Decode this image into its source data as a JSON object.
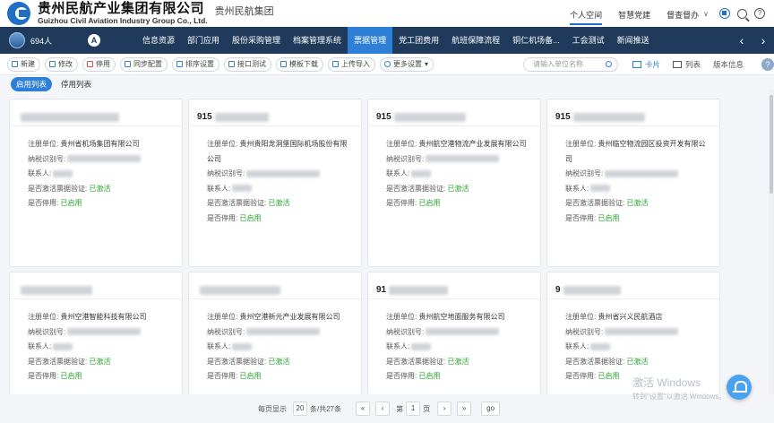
{
  "header": {
    "logo_cn": "贵州民航产业集团有限公司",
    "logo_en": "Guizhou Civil Aviation Industry Group Co., Ltd.",
    "sub": "贵州民航集团",
    "links": [
      "个人空间",
      "智慧党建",
      "督查督办"
    ]
  },
  "nav": {
    "user_count": "694人",
    "a_label": "A",
    "items": [
      "信息资源",
      "部门应用",
      "股份采购管理",
      "档案管理系统",
      "票据管理",
      "党工团费用",
      "航班保障流程",
      "铜仁机场备...",
      "工会测试",
      "新闻推送"
    ],
    "left_arrow": "‹",
    "right_arrow": "›"
  },
  "toolbar": {
    "buttons": [
      "新建",
      "修改",
      "停用",
      "同步配置",
      "排序设置",
      "接口测试",
      "模板下载",
      "上传导入",
      "更多设置"
    ],
    "search_placeholder": "请输入单位名称",
    "view_card": "卡片",
    "view_list": "列表",
    "version": "版本信息",
    "help": "?"
  },
  "subtabs": [
    "启用列表",
    "停用列表"
  ],
  "labels": {
    "unit": "注册单位:",
    "tax": "纳税识别号:",
    "contact": "联系人:",
    "activate": "是否激活票据验证:",
    "disabled": "是否停用:"
  },
  "cards": [
    {
      "code_prefix": "",
      "unit": "贵州省机场集团有限公司",
      "activate": "已激活",
      "disabled": "已启用"
    },
    {
      "code_prefix": "915",
      "unit": "贵州贵阳龙洞堡国际机场股份有限公司",
      "activate": "已激活",
      "disabled": "已启用"
    },
    {
      "code_prefix": "915",
      "unit": "贵州航空港物流产业发展有限公司",
      "activate": "已激活",
      "disabled": "已启用"
    },
    {
      "code_prefix": "915",
      "unit": "贵州临空物流园区投资开发有限公司",
      "activate": "已激活",
      "disabled": "已启用"
    },
    {
      "code_prefix": "",
      "unit": "贵州空港智能科技有限公司",
      "activate": "已激活",
      "disabled": "已启用"
    },
    {
      "code_prefix": "",
      "unit": "贵州空港新元产业发展有限公司",
      "activate": "已激活",
      "disabled": "已启用"
    },
    {
      "code_prefix": "91",
      "unit": "贵州航空地面服务有限公司",
      "activate": "已激活",
      "disabled": "已启用"
    },
    {
      "code_prefix": "9",
      "unit": "贵州省兴义民航酒店",
      "activate": "已激活",
      "disabled": "已启用"
    }
  ],
  "pager": {
    "per_page_label": "每页显示",
    "per_page": "20",
    "total": "条/共27条",
    "first": "«",
    "prev": "‹",
    "page_prefix": "第",
    "page": "1",
    "page_suffix": "页",
    "next": "›",
    "last": "»",
    "go": "go"
  },
  "watermark": {
    "line1": "激活 Windows",
    "line2": "转到\"设置\"以激活 Windows。"
  }
}
